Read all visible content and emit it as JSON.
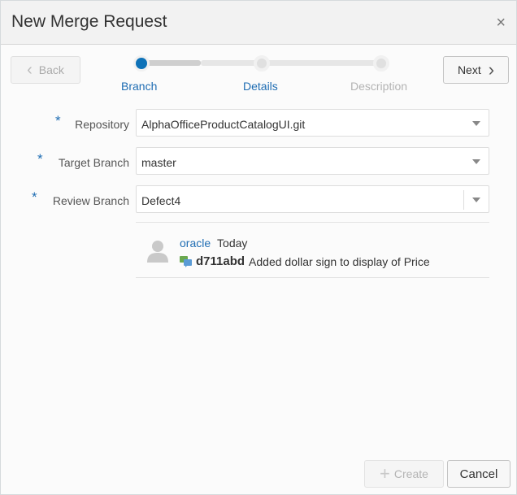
{
  "dialog": {
    "title": "New Merge Request",
    "close_glyph": "×"
  },
  "wizard": {
    "back_label": "Back",
    "next_label": "Next",
    "steps": [
      {
        "label": "Branch",
        "state": "current"
      },
      {
        "label": "Details",
        "state": "next"
      },
      {
        "label": "Description",
        "state": "disabled"
      }
    ]
  },
  "form": {
    "required_marker": "*",
    "repository": {
      "label": "Repository",
      "value": "AlphaOfficeProductCatalogUI.git"
    },
    "target_branch": {
      "label": "Target Branch",
      "value": "master"
    },
    "review_branch": {
      "label": "Review Branch",
      "value": "Defect4"
    }
  },
  "commit": {
    "author": "oracle",
    "date": "Today",
    "hash": "d711abd",
    "message": "Added dollar sign to display of Price"
  },
  "footer": {
    "create_label": "Create",
    "cancel_label": "Cancel"
  },
  "colors": {
    "accent": "#1f6db3",
    "step_active": "#0e72b8"
  }
}
